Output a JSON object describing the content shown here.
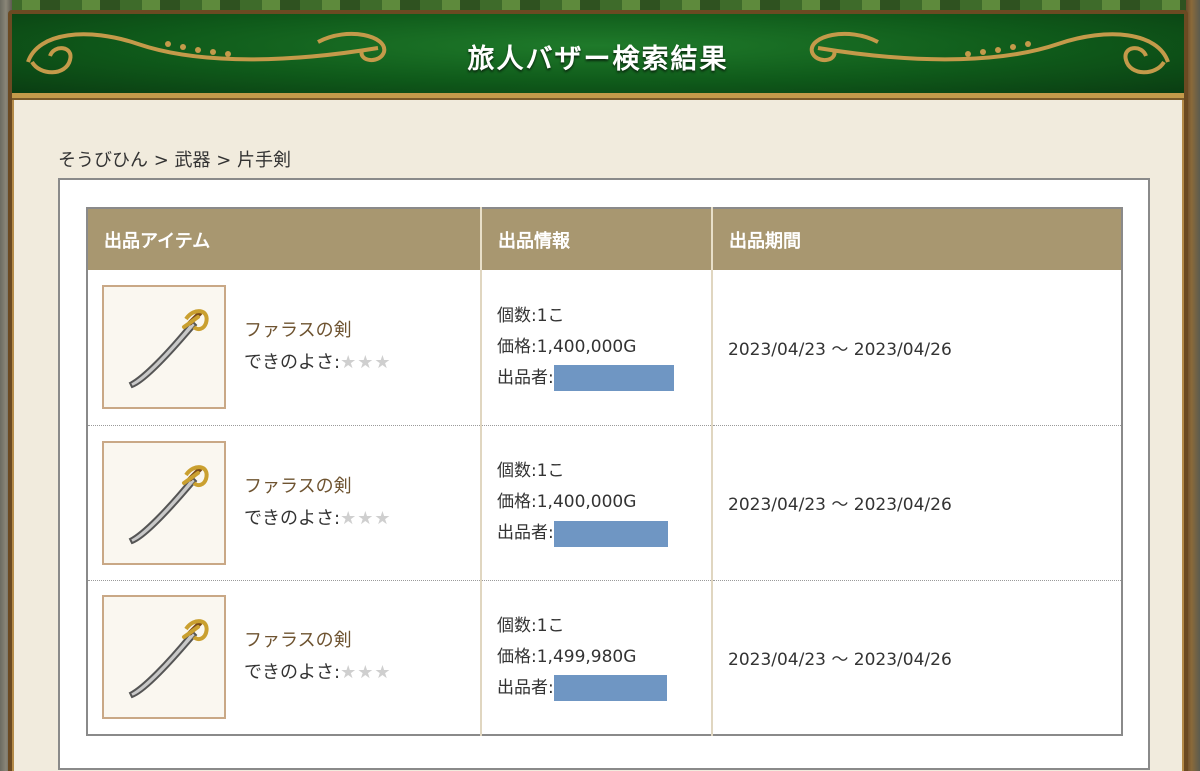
{
  "header": {
    "title": "旅人バザー検索結果"
  },
  "breadcrumb": "そうびひん > 武器 > 片手剣",
  "table": {
    "columns": [
      "出品アイテム",
      "出品情報",
      "出品期間"
    ],
    "rows": [
      {
        "item_name": "ファラスの剣",
        "quality_label": "できのよさ:",
        "stars": "★★★",
        "qty": "個数:1こ",
        "price": "価格:1,400,000G",
        "seller_label": "出品者:",
        "period": "2023/04/23 〜 2023/04/26"
      },
      {
        "item_name": "ファラスの剣",
        "quality_label": "できのよさ:",
        "stars": "★★★",
        "qty": "個数:1こ",
        "price": "価格:1,400,000G",
        "seller_label": "出品者:",
        "period": "2023/04/23 〜 2023/04/26"
      },
      {
        "item_name": "ファラスの剣",
        "quality_label": "できのよさ:",
        "stars": "★★★",
        "qty": "個数:1こ",
        "price": "価格:1,499,980G",
        "seller_label": "出品者:",
        "period": "2023/04/23 〜 2023/04/26"
      }
    ]
  },
  "colors": {
    "header_green": "#0f5a1a",
    "table_header": "#a89770",
    "item_name": "#6e5330",
    "redaction": "#6f96c3"
  },
  "icons": {
    "item": "saber-icon"
  }
}
